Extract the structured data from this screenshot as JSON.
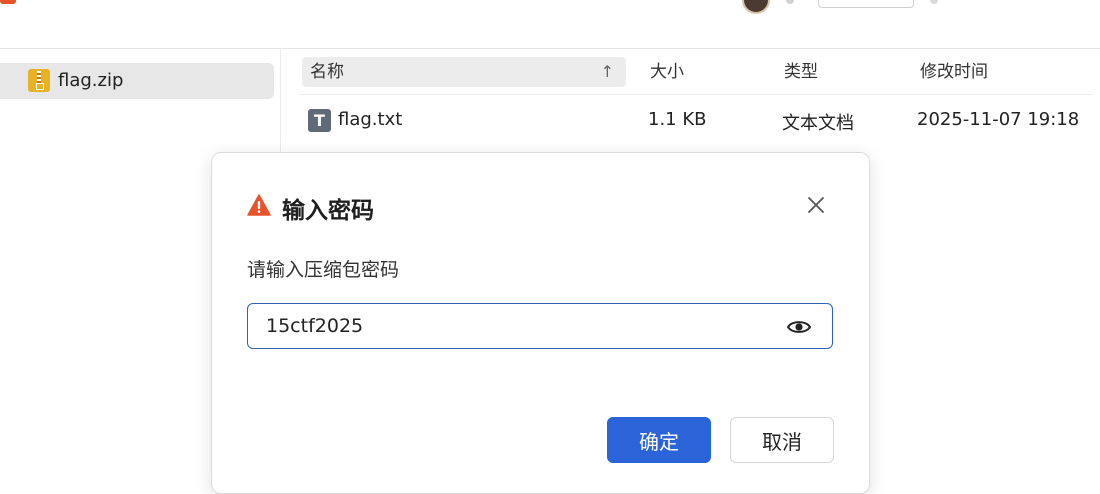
{
  "sidebar": {
    "items": [
      {
        "label": "flag.zip",
        "icon": "zip-archive-icon",
        "selected": true
      }
    ]
  },
  "file_table": {
    "columns": [
      "名称",
      "大小",
      "类型",
      "修改时间"
    ],
    "sort": {
      "column": "名称",
      "direction": "ascending"
    },
    "rows": [
      {
        "name": "flag.txt",
        "size": "1.1 KB",
        "type": "文本文档",
        "modified": "2025-11-07 19:18",
        "icon": "text-file-icon"
      }
    ]
  },
  "dialog": {
    "title": "输入密码",
    "prompt": "请输入压缩包密码",
    "password_value": "15ctf2025",
    "confirm_label": "确定",
    "cancel_label": "取消",
    "accent_color": "#2b63d9",
    "warning_color": "#e8532b"
  }
}
